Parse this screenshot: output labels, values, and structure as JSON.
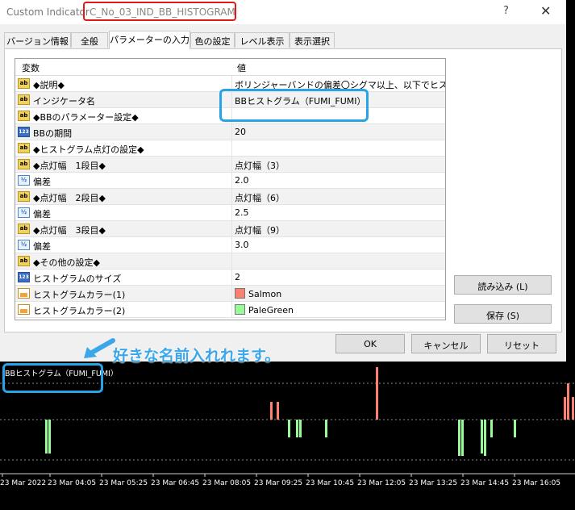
{
  "window": {
    "app_title": "Custom Indicator",
    "indicator_name": "C_No_03_IND_BB_HISTOGRAM",
    "help_label": "?",
    "close_label": "✕"
  },
  "tabs": [
    {
      "label": "バージョン情報"
    },
    {
      "label": "全般"
    },
    {
      "label": "パラメーターの入力"
    },
    {
      "label": "色の設定"
    },
    {
      "label": "レベル表示"
    },
    {
      "label": "表示選択"
    }
  ],
  "grid": {
    "col_var": "変数",
    "col_val": "値",
    "rows": [
      {
        "icon": "ab",
        "name": "◆説明◆",
        "value": "ボリンジャーバンドの偏差〇シグマ以上、以下でヒスト・.."
      },
      {
        "icon": "ab",
        "name": "インジケータ名",
        "value": "BBヒストグラム（FUMI_FUMI）"
      },
      {
        "icon": "ab",
        "name": "◆BBのパラメーター設定◆",
        "value": ""
      },
      {
        "icon": "123",
        "name": "BBの期間",
        "value": "20"
      },
      {
        "icon": "ab",
        "name": "◆ヒストグラム点灯の設定◆",
        "value": ""
      },
      {
        "icon": "ab",
        "name": "◆点灯幅　1段目◆",
        "value": "点灯幅（3）"
      },
      {
        "icon": "v2",
        "name": "偏差",
        "value": "2.0"
      },
      {
        "icon": "ab",
        "name": "◆点灯幅　2段目◆",
        "value": "点灯幅（6）"
      },
      {
        "icon": "v2",
        "name": "偏差",
        "value": "2.5"
      },
      {
        "icon": "ab",
        "name": "◆点灯幅　3段目◆",
        "value": "点灯幅（9）"
      },
      {
        "icon": "v2",
        "name": "偏差",
        "value": "3.0"
      },
      {
        "icon": "ab",
        "name": "◆その他の設定◆",
        "value": ""
      },
      {
        "icon": "123",
        "name": "ヒストグラムのサイズ",
        "value": "2"
      },
      {
        "icon": "color",
        "name": "ヒストグラムカラー(1)",
        "value": "Salmon",
        "swatch": "#fa8072"
      },
      {
        "icon": "color",
        "name": "ヒストグラムカラー(2)",
        "value": "PaleGreen",
        "swatch": "#98fb98"
      }
    ]
  },
  "icon_text": {
    "ab": "ab",
    "123": "123",
    "v2": "½",
    "color": ""
  },
  "buttons": {
    "load": "読み込み (L)",
    "save": "保存 (S)",
    "ok": "OK",
    "cancel": "キャンセル",
    "reset": "リセット"
  },
  "callout_text": "好きな名前入れれます。",
  "chart": {
    "indicator_label": "BBヒストグラム（FUMI_FUMI）",
    "time_labels": [
      "23 Mar 2022",
      "23 Mar 04:05",
      "23 Mar 05:25",
      "23 Mar 06:45",
      "23 Mar 08:05",
      "23 Mar 09:25",
      "23 Mar 10:45",
      "23 Mar 12:05",
      "23 Mar 13:25",
      "23 Mar 14:45",
      "23 Mar 16:05"
    ],
    "colors": {
      "up": "#fa8072",
      "down": "#98fb98",
      "dots": "#8a8a8a"
    }
  }
}
